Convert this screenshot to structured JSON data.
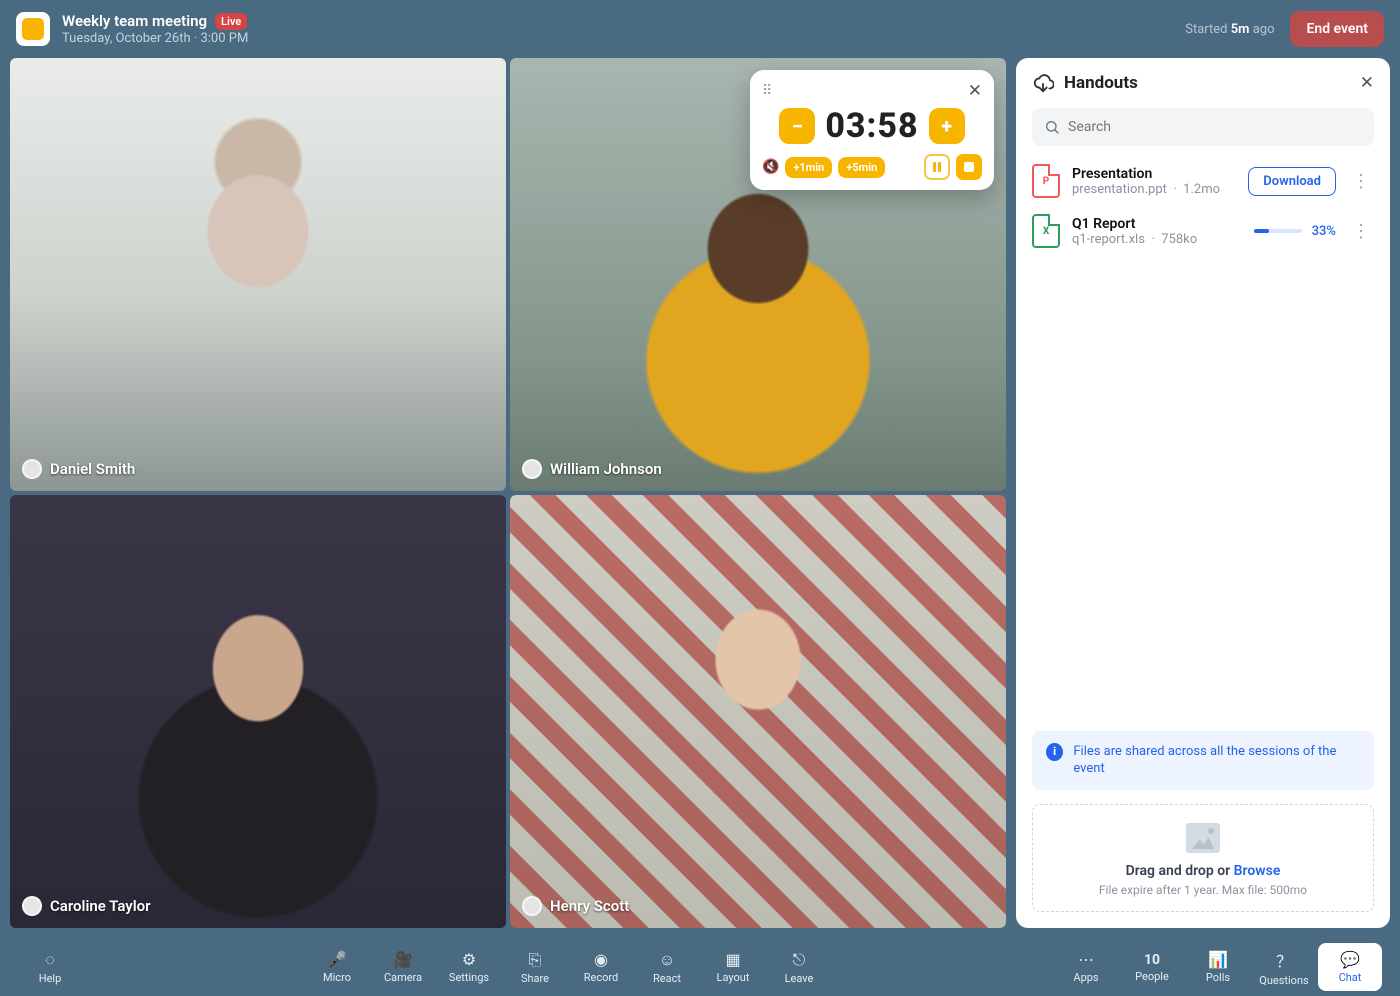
{
  "header": {
    "title": "Weekly team meeting",
    "live_badge": "Live",
    "subtitle": "Tuesday, October 26th · 3:00 PM",
    "started_prefix": "Started ",
    "started_value": "5m",
    "started_suffix": " ago",
    "end_label": "End event"
  },
  "participants": [
    {
      "name": "Daniel Smith"
    },
    {
      "name": "William Johnson"
    },
    {
      "name": "Caroline Taylor"
    },
    {
      "name": "Henry Scott"
    }
  ],
  "timer": {
    "time": "03:58",
    "minus": "−",
    "plus": "+",
    "plus1": "+1min",
    "plus5": "+5min"
  },
  "panel": {
    "title": "Handouts",
    "search_placeholder": "Search",
    "files": [
      {
        "name": "Presentation",
        "filename": "presentation.ppt",
        "size": "1.2mo",
        "kind": "ppt",
        "action": "Download"
      },
      {
        "name": "Q1 Report",
        "filename": "q1-report.xls",
        "size": "758ko",
        "kind": "xls",
        "progress": "33%"
      }
    ],
    "info": "Files are shared across all the sessions of the event",
    "drop_prefix": "Drag and drop or ",
    "drop_link": "Browse",
    "drop_sub": "File expire after 1 year. Max file: 500mo"
  },
  "bottom": {
    "help": "Help",
    "micro": "Micro",
    "camera": "Camera",
    "settings": "Settings",
    "share": "Share",
    "record": "Record",
    "react": "React",
    "layout": "Layout",
    "leave": "Leave",
    "apps": "Apps",
    "people_count": "10",
    "people": "People",
    "polls": "Polls",
    "questions": "Questions",
    "chat": "Chat"
  }
}
